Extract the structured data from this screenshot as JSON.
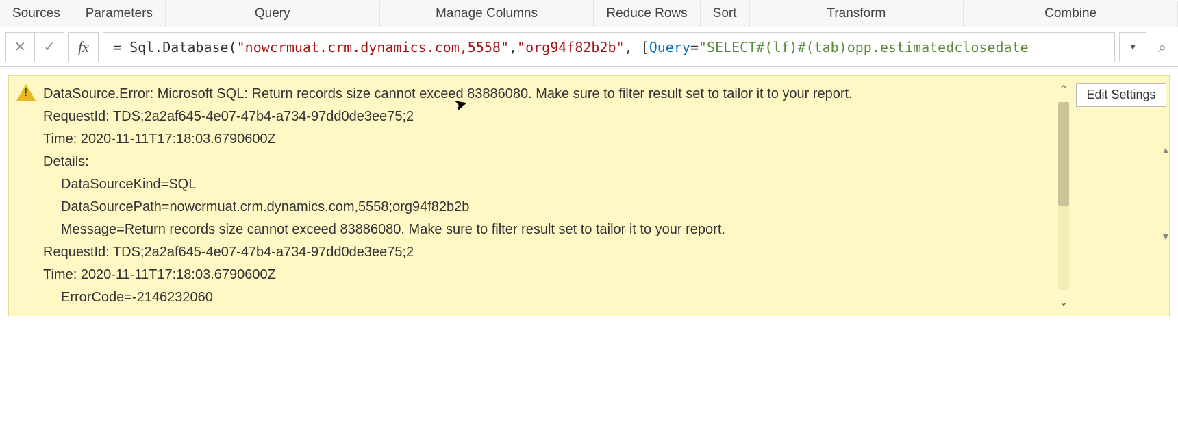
{
  "ribbon": {
    "sources": "Sources",
    "parameters": "Parameters",
    "query": "Query",
    "manage_columns": "Manage Columns",
    "reduce_rows": "Reduce Rows",
    "sort": "Sort",
    "transform": "Transform",
    "combine": "Combine"
  },
  "formula_bar": {
    "fx_label": "fx",
    "cancel_glyph": "✕",
    "accept_glyph": "✓",
    "dropdown_glyph": "▾",
    "search_glyph": "⌕",
    "prefix": "= Sql.Database(",
    "arg1": "\"nowcrmuat.crm.dynamics.com,5558\"",
    "sep1": ", ",
    "arg2": "\"org94f82b2b\"",
    "sep2": ", [",
    "param_key": "Query",
    "eq": "=",
    "arg3": "\"SELECT#(lf)#(tab)opp.estimatedclosedate"
  },
  "error": {
    "line1": "DataSource.Error: Microsoft SQL: Return records size cannot exceed 83886080. Make sure to filter result set to tailor it to your report.",
    "line2": "RequestId: TDS;2a2af645-4e07-47b4-a734-97dd0de3ee75;2",
    "line3": "Time: 2020-11-11T17:18:03.6790600Z",
    "line4": "Details:",
    "line5": "DataSourceKind=SQL",
    "line6": "DataSourcePath=nowcrmuat.crm.dynamics.com,5558;org94f82b2b",
    "line7": "Message=Return records size cannot exceed 83886080. Make sure to filter result set to tailor it to your report.",
    "line8": "RequestId: TDS;2a2af645-4e07-47b4-a734-97dd0de3ee75;2",
    "line9": "Time: 2020-11-11T17:18:03.6790600Z",
    "line10": "ErrorCode=-2146232060",
    "edit_settings": "Edit Settings",
    "scroll_up": "⌃",
    "scroll_down": "⌄"
  }
}
